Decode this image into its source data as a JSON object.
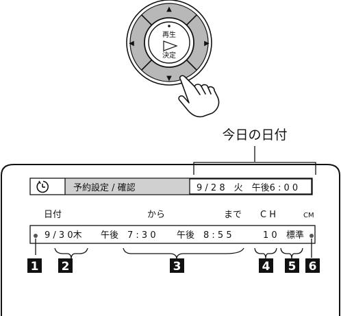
{
  "remote": {
    "center_top": "再生",
    "center_bottom": "決定",
    "arrow_up": "▲",
    "arrow_down": "▼",
    "arrow_left": "◀",
    "arrow_right": "▶"
  },
  "today_label": "今日の日付",
  "screen": {
    "title": "予約設定 / 確認",
    "current_datetime": "9 / 2 8　火　午後6 : 0 0",
    "headers": {
      "date": "日付",
      "from": "から",
      "to": "まで",
      "ch": "C H",
      "cm": "CM"
    },
    "row": {
      "date": "9 / 3 0木",
      "from": "午後　7 : 3 0",
      "to": "午後　8 : 5 5",
      "ch": "1 0",
      "mode": "標準"
    }
  },
  "callouts": [
    "1",
    "2",
    "3",
    "4",
    "5",
    "6"
  ],
  "colors": {
    "ring_gray": "#b8b8b8",
    "title_bar_gray": "#d0d0d0",
    "callout_bg": "#111111"
  }
}
